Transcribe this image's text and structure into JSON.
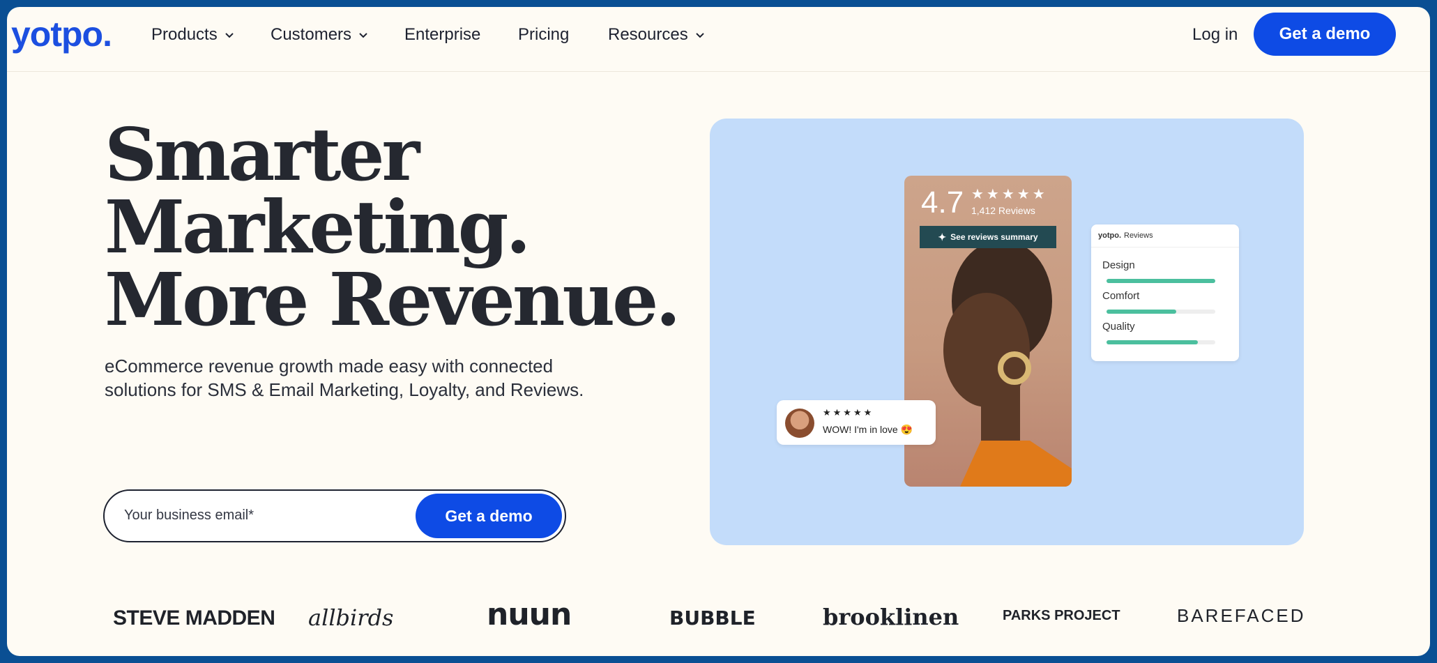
{
  "header": {
    "logo": "yotpo.",
    "nav": [
      {
        "label": "Products",
        "dropdown": true
      },
      {
        "label": "Customers",
        "dropdown": true
      },
      {
        "label": "Enterprise",
        "dropdown": false
      },
      {
        "label": "Pricing",
        "dropdown": false
      },
      {
        "label": "Resources",
        "dropdown": true
      }
    ],
    "login": "Log in",
    "cta": "Get a demo"
  },
  "hero": {
    "headline": [
      "Smarter",
      "Marketing.",
      "More Revenue."
    ],
    "subtitle": "eCommerce revenue growth made easy with connected solutions for SMS & Email Marketing, Loyalty, and Reviews.",
    "email_placeholder": "Your business email*",
    "cta": "Get a demo"
  },
  "visual": {
    "rating": "4.7",
    "stars": "★★★★★",
    "review_count": "1,412 Reviews",
    "summary_button": "See reviews summary",
    "reviews_card": {
      "brand": "yotpo.",
      "title": "Reviews",
      "items": [
        {
          "label": "Design",
          "level": 1.0
        },
        {
          "label": "Comfort",
          "level": 0.64
        },
        {
          "label": "Quality",
          "level": 0.84
        }
      ]
    },
    "review_snippet": {
      "stars": "★★★★★",
      "text": "WOW! I'm in love 😍"
    }
  },
  "brands": [
    "STEVE MADDEN",
    "allbirds",
    "nuun",
    "BUBBLE",
    "brooklinen",
    "PARKS PROJECT",
    "BAREFACED"
  ],
  "colors": {
    "accent": "#0e4be5",
    "panel": "#c3dcfa",
    "frame": "#0a4f93",
    "bar": "#4bbf9e"
  }
}
